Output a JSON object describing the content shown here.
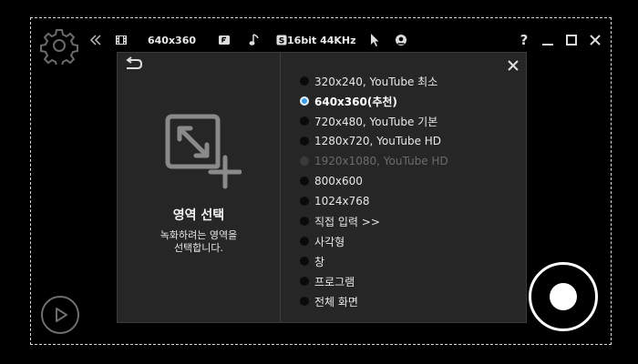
{
  "toolbar": {
    "collapse_icon": "double-chevron-left-icon",
    "size_label": "640x360",
    "audio_label": "16bit 44KHz"
  },
  "window_controls": {
    "help_label": "?"
  },
  "area_panel": {
    "title": "영역 선택",
    "description_line1": "녹화하려는 영역을",
    "description_line2": "선택합니다."
  },
  "options": [
    {
      "label": "320x240, YouTube 최소",
      "state": "normal"
    },
    {
      "label": "640x360(추천)",
      "state": "selected"
    },
    {
      "label": "720x480, YouTube 기본",
      "state": "normal"
    },
    {
      "label": "1280x720, YouTube HD",
      "state": "normal"
    },
    {
      "label": "1920x1080, YouTube HD",
      "state": "disabled"
    },
    {
      "label": "800x600",
      "state": "normal"
    },
    {
      "label": "1024x768",
      "state": "normal"
    },
    {
      "label": "직접 입력 >>",
      "state": "normal"
    },
    {
      "label": "사각형",
      "state": "normal"
    },
    {
      "label": "창",
      "state": "normal"
    },
    {
      "label": "프로그램",
      "state": "normal"
    },
    {
      "label": "전체 화면",
      "state": "normal"
    }
  ],
  "colors": {
    "background": "#000000",
    "panel": "#262626",
    "selected_radio": "#3b9de8",
    "disabled_text": "#6b6b6b"
  }
}
